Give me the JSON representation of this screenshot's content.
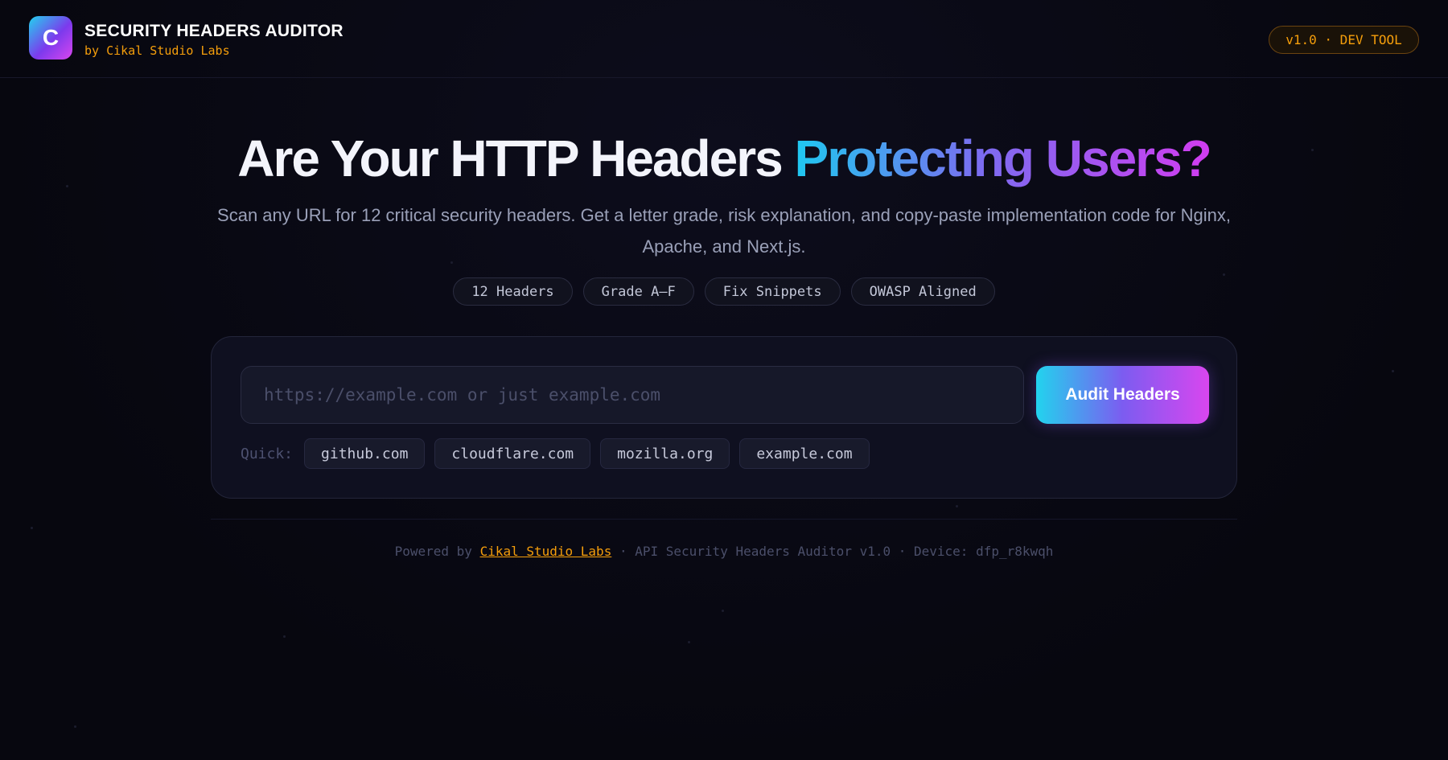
{
  "header": {
    "logo_letter": "C",
    "title": "SECURITY HEADERS AUDITOR",
    "subtitle": "by Cikal Studio Labs",
    "version_badge": "v1.0 · DEV TOOL"
  },
  "hero": {
    "title_plain": "Are Your HTTP Headers ",
    "title_gradient": "Protecting Users?",
    "subtitle": "Scan any URL for 12 critical security headers. Get a letter grade, risk explanation, and copy-paste implementation code for Nginx, Apache, and Next.js.",
    "chips": [
      "12 Headers",
      "Grade A–F",
      "Fix Snippets",
      "OWASP Aligned"
    ]
  },
  "scan": {
    "input_value": "",
    "placeholder": "https://example.com or just example.com",
    "button_label": "Audit Headers",
    "quick_label": "Quick:",
    "quick_items": [
      "github.com",
      "cloudflare.com",
      "mozilla.org",
      "example.com"
    ]
  },
  "footer": {
    "prefix": "Powered by ",
    "link_text": "Cikal Studio Labs",
    "suffix": " · API Security Headers Auditor v1.0 · Device: dfp_r8kwqh"
  },
  "colors": {
    "background": "#07070f",
    "accent_orange": "#f59e0b",
    "gradient_start": "#22d3ee",
    "gradient_mid": "#7c5cf0",
    "gradient_end": "#d946ef"
  }
}
